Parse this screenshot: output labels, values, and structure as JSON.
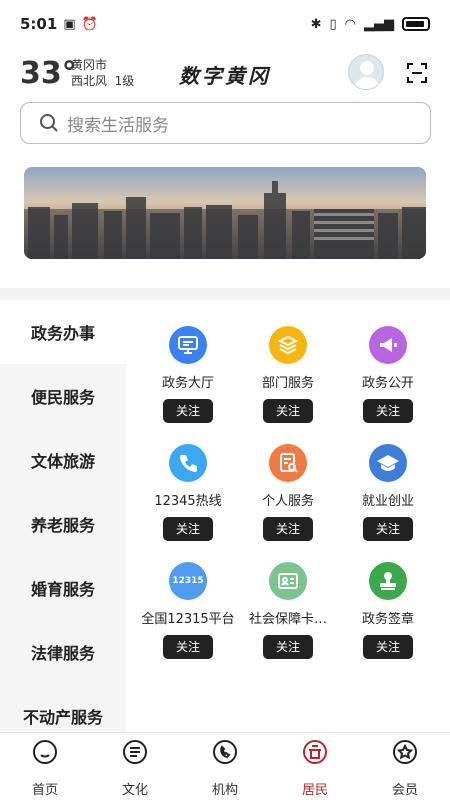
{
  "status_bar": {
    "time": "5:01"
  },
  "header": {
    "temperature": "33°",
    "city": "黄冈市",
    "wind": "西北风  1级",
    "app_title": "数字黄冈"
  },
  "search": {
    "placeholder": "搜索生活服务"
  },
  "categories": [
    {
      "label": "政务办事",
      "active": true
    },
    {
      "label": "便民服务"
    },
    {
      "label": "文体旅游"
    },
    {
      "label": "养老服务"
    },
    {
      "label": "婚育服务"
    },
    {
      "label": "法律服务"
    },
    {
      "label": "不动产服务"
    }
  ],
  "services": [
    {
      "name": "政务大厅",
      "follow": "关注",
      "icon": "monitor-icon",
      "color": "#3b82f0"
    },
    {
      "name": "部门服务",
      "follow": "关注",
      "icon": "layers-icon",
      "color": "#f5b60f"
    },
    {
      "name": "政务公开",
      "follow": "关注",
      "icon": "megaphone-icon",
      "color": "#b865e0"
    },
    {
      "name": "12345热线",
      "follow": "关注",
      "icon": "phone-icon",
      "color": "#3ca7f2"
    },
    {
      "name": "个人服务",
      "follow": "关注",
      "icon": "document-search-icon",
      "color": "#f07b45"
    },
    {
      "name": "就业创业",
      "follow": "关注",
      "icon": "graduation-cap-icon",
      "color": "#3d7ed8"
    },
    {
      "name": "全国12315平台",
      "follow": "关注",
      "icon": "badge-12315-icon",
      "color": "#4f9cf0",
      "icon_text": "12315"
    },
    {
      "name": "社会保障卡…",
      "follow": "关注",
      "icon": "id-card-icon",
      "color": "#7cc48d"
    },
    {
      "name": "政务签章",
      "follow": "关注",
      "icon": "stamp-icon",
      "color": "#3aa94b"
    }
  ],
  "tabbar": [
    {
      "label": "首页",
      "icon": "home-icon"
    },
    {
      "label": "文化",
      "icon": "culture-icon"
    },
    {
      "label": "机构",
      "icon": "institution-icon"
    },
    {
      "label": "居民",
      "icon": "resident-icon",
      "active": true
    },
    {
      "label": "会员",
      "icon": "member-icon"
    }
  ],
  "colors": {
    "accent": "#b3282d",
    "follow_button": "#222222"
  }
}
